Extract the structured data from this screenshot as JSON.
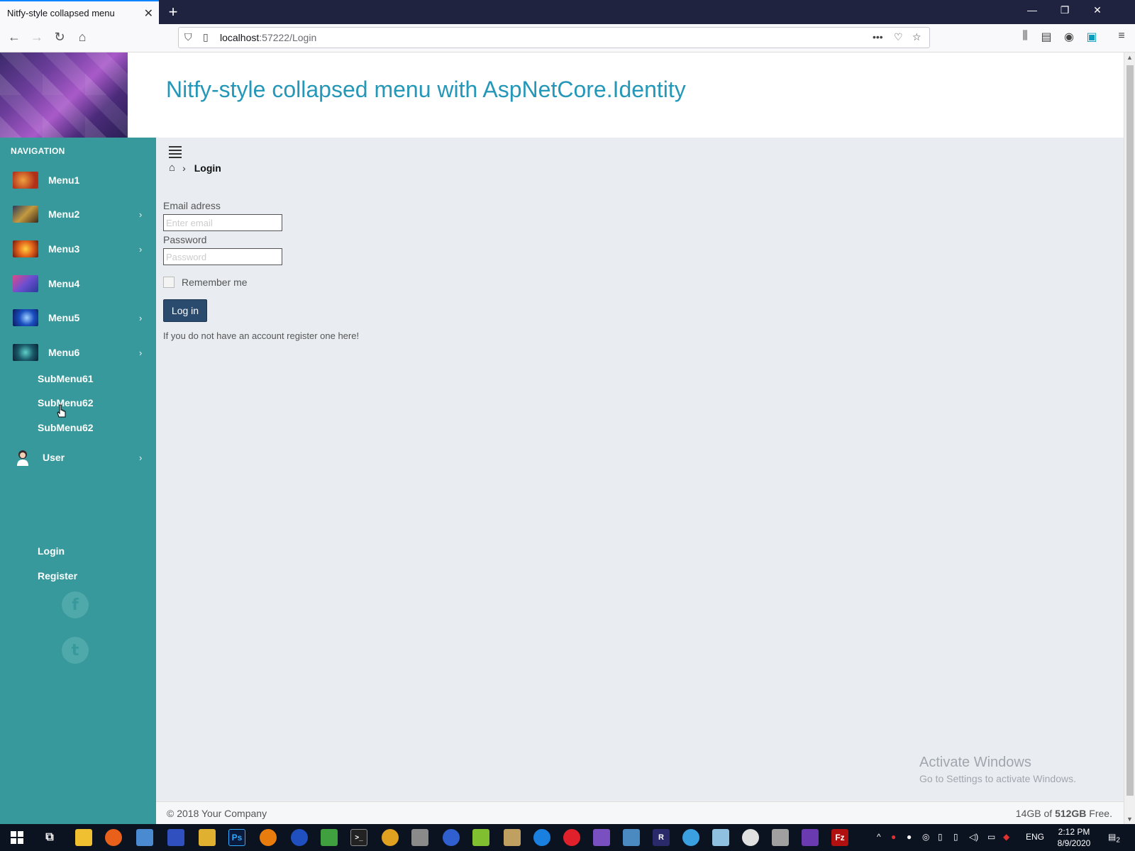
{
  "browser": {
    "tab_title": "Nitfy-style collapsed menu",
    "tab_close": "✕",
    "new_tab": "+",
    "url_host": "localhost",
    "url_path": ":57222/Login",
    "window_controls": [
      "—",
      "❐",
      "✕"
    ]
  },
  "header": {
    "title": "Nitfy-style collapsed menu with AspNetCore.Identity"
  },
  "sidebar": {
    "nav_title": "NAVIGATION",
    "items": [
      {
        "label": "Menu1",
        "has_children": false,
        "thumb_color": "#c4501e"
      },
      {
        "label": "Menu2",
        "has_children": true,
        "thumb_color": "#8a6a3a"
      },
      {
        "label": "Menu3",
        "has_children": true,
        "thumb_color": "#e0781a"
      },
      {
        "label": "Menu4",
        "has_children": false,
        "thumb_color": "#6a4fb8"
      },
      {
        "label": "Menu5",
        "has_children": true,
        "thumb_color": "#1a4fb0"
      },
      {
        "label": "Menu6",
        "has_children": true,
        "thumb_color": "#1f6a70"
      }
    ],
    "submenus": [
      "SubMenu61",
      "SubMenu62",
      "SubMenu62"
    ],
    "user": {
      "label": "User"
    },
    "user_links": [
      "Login",
      "Register"
    ],
    "social": [
      {
        "icon": "facebook-icon",
        "glyph": "f"
      },
      {
        "icon": "twitter-icon",
        "glyph": "t"
      }
    ]
  },
  "breadcrumb": {
    "current": "Login"
  },
  "form": {
    "email_label": "Email adress",
    "email_placeholder": "Enter email",
    "password_label": "Password",
    "password_placeholder": "Password",
    "remember_label": "Remember me",
    "remember_checked": false,
    "login_button": "Log in",
    "register_text": "If you do not have an account register one here!"
  },
  "watermark": {
    "line1": "Activate Windows",
    "line2": "Go to Settings to activate Windows."
  },
  "footer": {
    "copyright": "© 2018 Your Company",
    "disk_prefix": "14GB of ",
    "disk_total": "512GB",
    "disk_suffix": " Free."
  },
  "taskbar": {
    "language": "ENG",
    "time": "2:12 PM",
    "date": "8/9/2020",
    "notification_count": "2"
  }
}
